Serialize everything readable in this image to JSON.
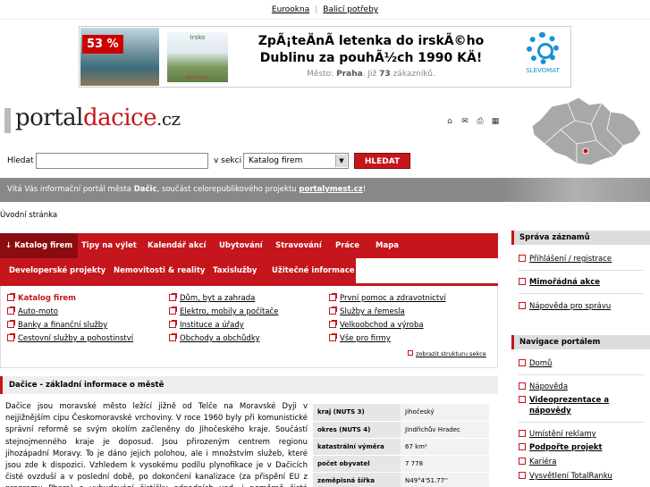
{
  "topbar": {
    "links": [
      "Eurookna",
      "Balicí potřeby"
    ]
  },
  "banner": {
    "discount": "53 %",
    "partner_logo_text": "Irsko",
    "partner_logo_sub": "your story",
    "headline": "ZpÃ¡teÄnÃ letenka do irskÃ©ho Dublinu za pouhÃ½ch 1990 KÄ!",
    "sub_prefix": "Město:",
    "sub_city": "Praha",
    "sub_mid": ". Již",
    "sub_count": "73",
    "sub_suffix": "zákazníků.",
    "brand": "SLEVOMAT"
  },
  "logo": {
    "part1": "portal",
    "part2": "dacice",
    "part3": ".cz"
  },
  "tool_icons": [
    "home-icon",
    "mail-icon",
    "print-icon",
    "map-icon"
  ],
  "search": {
    "label": "Hledat",
    "value": "",
    "section_label": "v sekci",
    "section_value": "Katalog firem",
    "button": "HLEDAT"
  },
  "welcome": {
    "pre": "Vítá Vás informační portál města ",
    "city": "Dačic",
    "mid": ", součást celorepublikového projektu ",
    "project": "portalymest.cz",
    "end": "!"
  },
  "breadcrumb": "Úvodní stránka",
  "nav": {
    "row1": [
      "↓ Katalog firem",
      "Tipy na výlet",
      "Kalendář akcí",
      "Ubytování",
      "Stravování",
      "Práce",
      "Mapa"
    ],
    "row2": [
      "Developerské projekty",
      "Nemovitosti & reality",
      "Taxislužby",
      "Užitečné informace"
    ]
  },
  "categories": {
    "col1": [
      "Katalog firem",
      "Auto-moto",
      "Banky a finanční služby",
      "Cestovní služby a pohostinství"
    ],
    "col2": [
      "Dům, byt a zahrada",
      "Elektro, mobily a počítače",
      "Instituce a úřady",
      "Obchody a obchůdky"
    ],
    "col3": [
      "První pomoc a zdravotnictví",
      "Služby a řemesla",
      "Velkoobchod a výroba",
      "Vše pro firmy"
    ],
    "more": "zobrazit strukturu sekce"
  },
  "info": {
    "title": "Dačice - základní informace o městě",
    "text": "Dačice jsou moravské město ležící jižně od Telče na Moravské Dyji v nejjižnějším cípu Českomoravské vrchoviny. V roce 1960 byly při komunistické správní reformě se svým okolím začleněny do Jihočeského kraje. Součástí stejnojmenného kraje je doposud. Jsou přirozeným centrem regionu jihozápadní Moravy. To je dáno jejich polohou, ale i množstvím služeb, které jsou zde k dispozici. Vzhledem k vysokému podílu plynofikace je v Dačicích čisté ovzduší a v poslední době, po dokončení kanalizace (za přispění EU z programu Phare) a vybudování čističky odpadních vod, i poměrně čistá Moravská Dyje. Okolní lesy,",
    "table": [
      {
        "k": "kraj (NUTS 3)",
        "v": "Jihočeský"
      },
      {
        "k": "okres (NUTS 4)",
        "v": "Jindřichův Hradec"
      },
      {
        "k": "katastrální výměra",
        "v": "67 km²"
      },
      {
        "k": "počet obyvatel",
        "v": "7 778"
      },
      {
        "k": "zeměpisná šířka",
        "v": "N49°4'51.77''"
      }
    ]
  },
  "sidebar": {
    "records_title": "Správa záznamů",
    "records": [
      "Přihlášení / registrace",
      "Mimořádná akce",
      "Nápověda pro správu"
    ],
    "nav_title": "Navigace portálem",
    "nav": [
      "Domů",
      "Nápověda",
      "Videoprezentace a",
      "nápovědy",
      "Umístění reklamy",
      "Podpořte projekt",
      "Kariéra",
      "Vysvětlení TotalRanku"
    ]
  }
}
